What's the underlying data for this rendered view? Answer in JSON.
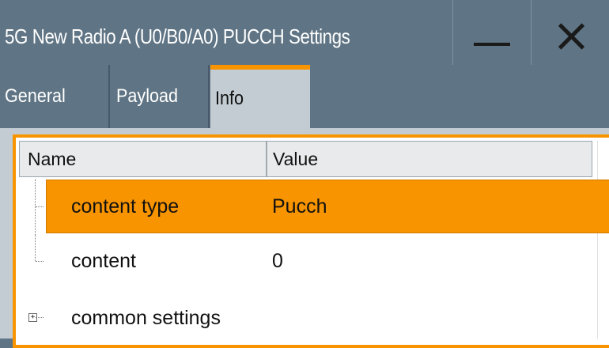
{
  "window": {
    "title": "5G New Radio A (U0/B0/A0) PUCCH Settings",
    "minimize_icon": "minimize-icon",
    "close_icon": "close-icon"
  },
  "tabs": [
    {
      "label": "General",
      "active": false
    },
    {
      "label": "Payload",
      "active": false
    },
    {
      "label": "Info",
      "active": true
    }
  ],
  "table": {
    "columns": [
      "Name",
      "Value"
    ],
    "rows": [
      {
        "name": "content type",
        "value": "Pucch",
        "selected": true
      },
      {
        "name": "content",
        "value": "0",
        "selected": false
      },
      {
        "name": "common settings",
        "value": "",
        "selected": false,
        "expandable": true
      }
    ]
  },
  "colors": {
    "accent": "#f79400",
    "titlebar": "#5f7484",
    "panel": "#c3ccd3"
  }
}
